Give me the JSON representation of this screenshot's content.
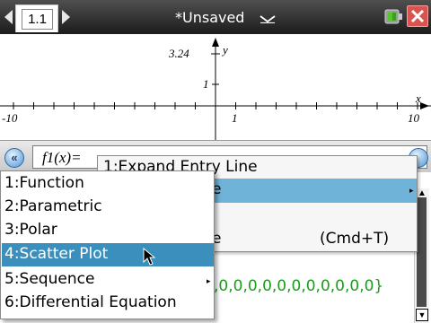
{
  "titlebar": {
    "tab_label": "1.1",
    "document_title": "*Unsaved"
  },
  "graph": {
    "x_min_label": "-10",
    "x_max_label": "10",
    "x_one_label": "1",
    "y_max_label": "3.24",
    "y_one_label": "1",
    "y_axis_label": "y",
    "x_axis_label": "x"
  },
  "entry": {
    "label": "f1(x)="
  },
  "context_menu": {
    "items": [
      {
        "label": "1:Expand Entry Line"
      },
      {
        "label": "e"
      },
      {
        "label": "e"
      },
      {
        "shortcut": "(Cmd+T)"
      }
    ]
  },
  "graph_type_menu": {
    "items": [
      {
        "label": "1:Function"
      },
      {
        "label": "2:Parametric"
      },
      {
        "label": "3:Polar"
      },
      {
        "label": "4:Scatter Plot",
        "selected": true
      },
      {
        "label": "5:Sequence",
        "has_submenu": true
      },
      {
        "label": "6:Differential Equation"
      }
    ]
  },
  "history": {
    "visible_expression": ",0,0,0,0,0,0,0,0,0,0,0}"
  },
  "colors": {
    "titlebar": "#2a2a2a",
    "submenu_highlight": "#3a8fbd",
    "parent_highlight": "#6fb3d9",
    "expression_green": "#1a9e1a",
    "close_button": "#d9534f"
  },
  "icons": [
    "nav-left-icon",
    "nav-right-icon",
    "dropdown-chevron-icon",
    "battery-icon",
    "close-icon",
    "expand-entry-icon",
    "mouse-cursor-icon",
    "submenu-arrow-icon",
    "scroll-up-icon",
    "scroll-down-icon"
  ]
}
